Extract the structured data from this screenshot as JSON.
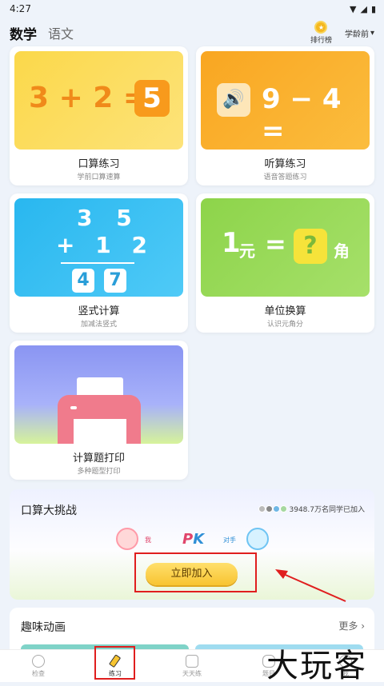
{
  "status": {
    "time": "4:27"
  },
  "header": {
    "tab_active": "数学",
    "tab_inactive": "语文",
    "rank_label": "排行榜",
    "grade_label": "学龄前"
  },
  "cards": [
    {
      "title": "口算练习",
      "subtitle": "学前口算速算",
      "art_text": "3 + 2 =",
      "art_answer": "5"
    },
    {
      "title": "听算练习",
      "subtitle": "语音答题练习",
      "art_text": "9 − 4 ="
    },
    {
      "title": "竖式计算",
      "subtitle": "加减法竖式",
      "art_top": "3 5",
      "art_mid": "+ 1 2",
      "art_ans1": "4",
      "art_ans2": "7"
    },
    {
      "title": "单位换算",
      "subtitle": "认识元角分",
      "art_left": "1",
      "art_unit1": "元",
      "art_eq": "=",
      "art_q": "?",
      "art_unit2": "角"
    },
    {
      "title": "计算题打印",
      "subtitle": "多种题型打印"
    }
  ],
  "challenge": {
    "title": "口算大挑战",
    "count_text": "3948.7万名同学已加入",
    "me": "我",
    "pk_p": "P",
    "pk_k": "K",
    "opponent": "对手",
    "join": "立即加入"
  },
  "animation": {
    "title": "趣味动画",
    "more": "更多 ›"
  },
  "nav": [
    {
      "label": "检查"
    },
    {
      "label": "练习"
    },
    {
      "label": "天天练"
    },
    {
      "label": "题目"
    },
    {
      "label": "我"
    }
  ],
  "watermark": "大玩客",
  "colors": {
    "highlight_red": "#e01e1e",
    "card1_bg": "#fbd84a",
    "card2_bg": "#f9a621",
    "card3_bg": "#29b7ef",
    "card4_bg": "#8dd44a",
    "card5_bg": "#8a95f2"
  }
}
